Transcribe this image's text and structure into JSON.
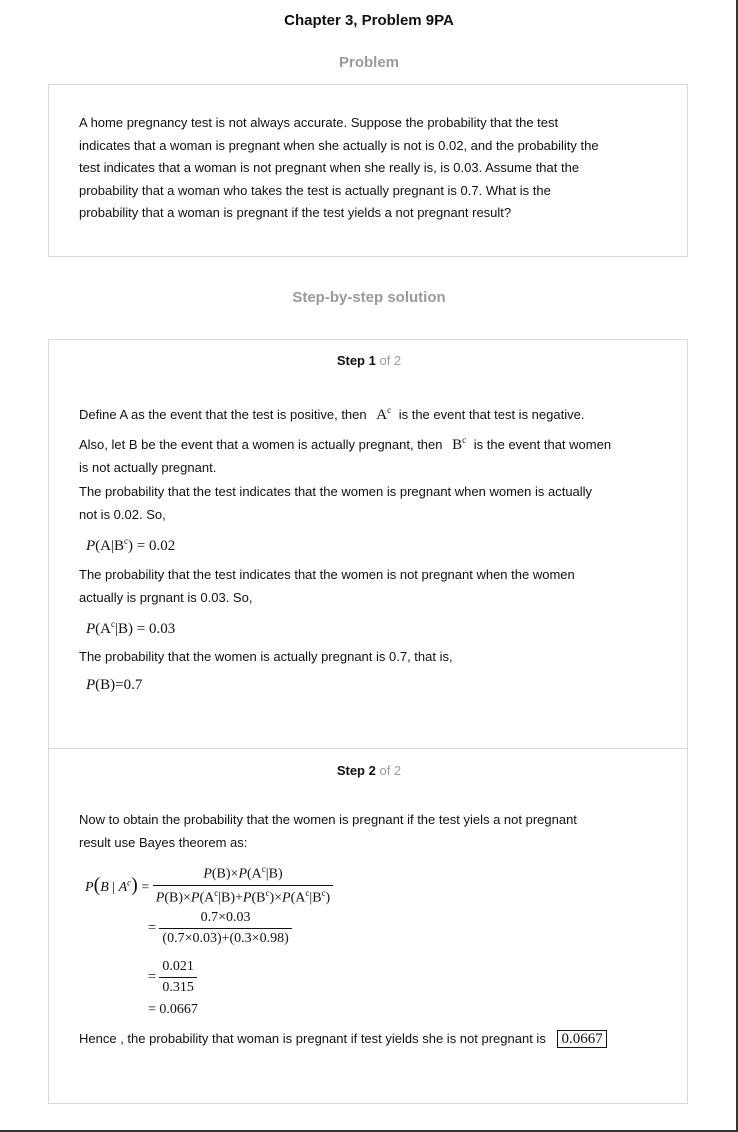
{
  "header": {
    "title": "Chapter 3, Problem 9PA",
    "problem_label": "Problem",
    "solution_label": "Step-by-step solution"
  },
  "problem": {
    "lines": [
      "A home pregnancy test is not always accurate. Suppose the probability that the test",
      "indicates that a woman is pregnant when she actually is not is 0.02, and the probability the",
      "test indicates that a woman is not pregnant when she really is, is 0.03. Assume that the",
      "probability that a woman who takes the test is actually pregnant is 0.7. What is the",
      "probability that a woman is pregnant if the test yields a not pregnant result?"
    ]
  },
  "step1": {
    "label": "Step 1",
    "of": "of 2",
    "p1_pre": "Define A as the event that the test is positive, then",
    "p1_post": "is the event that test is negative.",
    "p2_pre": "Also, let B be the event that a women is actually pregnant, then",
    "p2_post": "is the event that women",
    "p2_line2": "is not actually pregnant.",
    "p3_line1": "The probability that the test indicates that the women is pregnant when women is actually",
    "p3_line2": "not is 0.02. So,",
    "eq1": "P(A|B^c) = 0.02",
    "p4_line1": "The probability that the test indicates that the women is not pregnant when the women",
    "p4_line2": "actually is prgnant is 0.03. So,",
    "eq2": "P(A^c|B) = 0.03",
    "p5": "The probability that the women is actually pregnant is 0.7, that is,",
    "eq3": "P(B)=0.7"
  },
  "step2": {
    "label": "Step 2",
    "of": "of 2",
    "p1_line1": "Now to obtain the probability that the women is pregnant if the test yiels a not pregnant",
    "p1_line2": "result use Bayes theorem as:",
    "num2": "0.7×0.03",
    "den2": "(0.7×0.03)+(0.3×0.98)",
    "num3": "0.021",
    "den3": "0.315",
    "result": "= 0.0667",
    "conclusion": "Hence , the probability that woman is pregnant if test yields she is not pregnant is",
    "answer": "0.0667"
  }
}
